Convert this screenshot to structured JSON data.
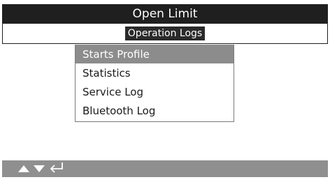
{
  "header": {
    "title": "Open Limit"
  },
  "subheader": {
    "label": "Operation Logs"
  },
  "menu": {
    "items": [
      {
        "label": "Starts Profile",
        "selected": true
      },
      {
        "label": "Statistics",
        "selected": false
      },
      {
        "label": "Service Log",
        "selected": false
      },
      {
        "label": "Bluetooth Log",
        "selected": false
      }
    ]
  },
  "footer": {
    "icons": [
      "arrow-up-icon",
      "arrow-down-icon",
      "enter-return-icon"
    ]
  },
  "colors": {
    "header_bg": "#1f1f1f",
    "selected_bg": "#8c8c8c",
    "footer_bg": "#8f8f8f"
  }
}
